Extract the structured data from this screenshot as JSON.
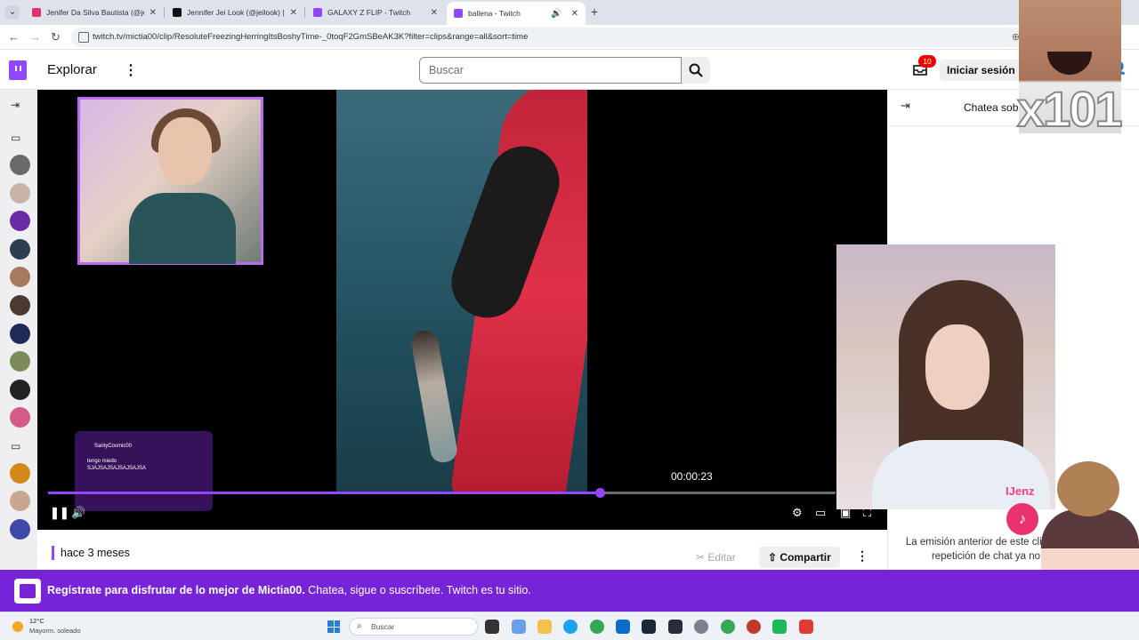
{
  "browser": {
    "tabs": [
      {
        "title": "Jenifer Da Silva Bautista (@jenifer",
        "fav_color": "#e1306c"
      },
      {
        "title": "Jennifer Jei Look (@jeilook) | TikTok",
        "fav_color": "#111111"
      },
      {
        "title": "GALAXY Z FLIP - Twitch",
        "fav_color": "#9146ff"
      },
      {
        "title": "ballena - Twitch",
        "fav_color": "#9146ff",
        "active": true
      }
    ],
    "url": "twitch.tv/mictia00/clip/ResoluteFreezingHerringItsBoshyTime-_0toqF2GmSBeAK3K?filter=clips&range=all&sort=time"
  },
  "header": {
    "explorar": "Explorar",
    "search_placeholder": "Buscar",
    "notifications_count": "10",
    "login_label": "Iniciar sesión"
  },
  "player": {
    "chat_overlay_user": "SantyCosmic00",
    "chat_overlay_msg1": "tengo miedo",
    "chat_overlay_msg2": "SJAJSAJSAJSAJSAJSA",
    "tooltip_time": "00:00:23",
    "progress": 0.7
  },
  "clip_meta": {
    "time_ago": "hace 3 meses",
    "edit_label": "Editar",
    "share_label": "Compartir"
  },
  "chat": {
    "title": "Chatea sobre este clip",
    "note": "La emisión anterior de este clip y la repetición de chat ya no"
  },
  "overlays": {
    "meme_text": "x101",
    "webcam_name": "IJenz"
  },
  "banner": {
    "strong": "Regístrate para disfrutar de lo mejor de Mictia00.",
    "rest": "Chatea, sigue o suscríbete. Twitch es tu sitio."
  },
  "taskbar": {
    "temp": "12°C",
    "weather": "Mayorm. soleado",
    "search_placeholder": "Buscar"
  },
  "colors": {
    "twitch_purple": "#9146ff",
    "banner_purple": "#7724d8",
    "badge_red": "#eb0400"
  }
}
